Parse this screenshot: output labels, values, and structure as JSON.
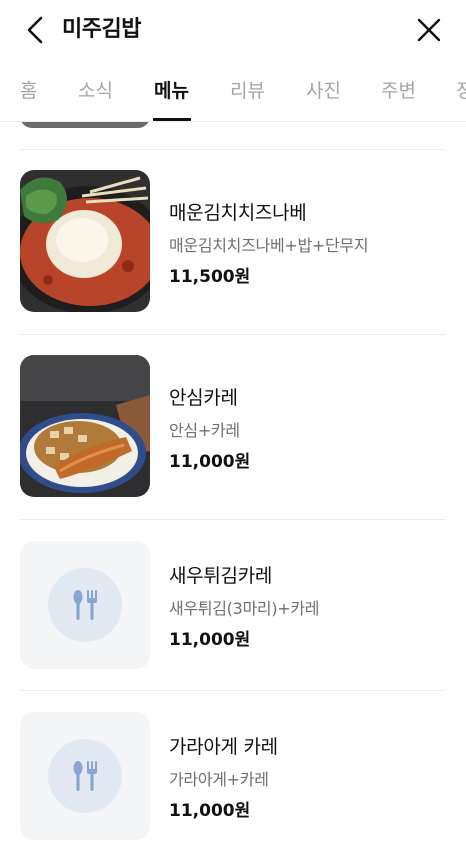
{
  "header": {
    "title": "미주김밥"
  },
  "tabs": [
    "홈",
    "소식",
    "메뉴",
    "리뷰",
    "사진",
    "주변",
    "정"
  ],
  "active_tab": "메뉴",
  "menu_items": [
    {
      "name": "매운김치치즈나베",
      "description": "매운김치치즈나베+밥+단무지",
      "price": "11,500원",
      "image": "kimchi-cheese-nabe-photo"
    },
    {
      "name": "안심카레",
      "description": "안심+카레",
      "price": "11,000원",
      "image": "tenderloin-curry-photo"
    },
    {
      "name": "새우튀김카레",
      "description": "새우튀김(3마리)+카레",
      "price": "11,000원",
      "image": "utensils-placeholder-icon"
    },
    {
      "name": "가라아게 카레",
      "description": "가라아게+카레",
      "price": "11,000원",
      "image": "utensils-placeholder-icon"
    }
  ],
  "colors": {
    "text": "#111111",
    "muted": "#707070",
    "tab_inactive": "#a6a6a6",
    "placeholder_bg": "#f4f5f7",
    "placeholder_icon": "#8aa5d3"
  }
}
